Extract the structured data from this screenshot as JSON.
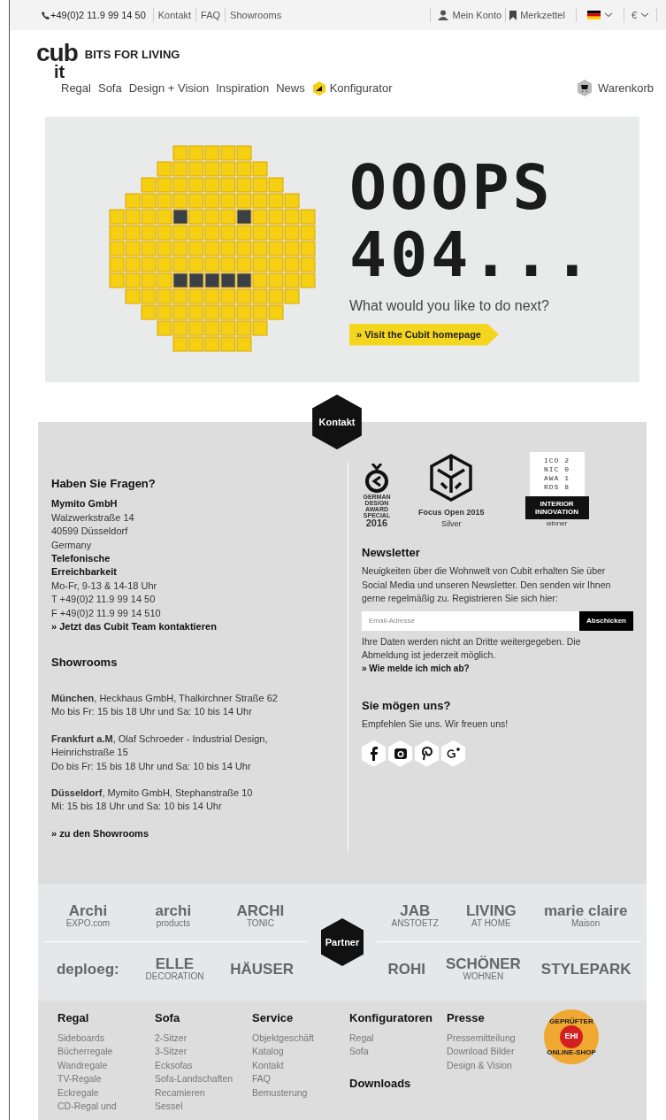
{
  "top_bar": {
    "phone": "+49(0)2 11.9 99 14 50",
    "links": [
      "Kontakt",
      "FAQ",
      "Showrooms"
    ],
    "account": "Mein Konto",
    "wishlist": "Merkzettel",
    "currency": "€"
  },
  "logo": {
    "top": "cub",
    "bottom": "it",
    "tagline": "BITS FOR LIVING"
  },
  "nav": [
    {
      "label": "Regal",
      "kind": "plain"
    },
    {
      "label": "Sofa",
      "kind": "plain"
    },
    {
      "label": "Design + Vision",
      "kind": "plain"
    },
    {
      "label": "Inspiration",
      "kind": "plain"
    },
    {
      "label": "News",
      "kind": "plain"
    },
    {
      "label": "Konfigurator",
      "kind": "configurator"
    }
  ],
  "cart": "Warenkorb",
  "hero": {
    "headline": [
      "OOOPS",
      "404..."
    ],
    "question": "What would you like to do next?",
    "button": "» Visit the Cubit homepage"
  },
  "kontakt_badge": "Kontakt",
  "contact": {
    "heading": "Haben Sie Fragen?",
    "lines": [
      {
        "text": "Mymito GmbH",
        "bold": true
      },
      {
        "text": "Walzwerkstraße 14",
        "bold": false
      },
      {
        "text": "40599 Düsseldorf",
        "bold": false
      },
      {
        "text": "Germany",
        "bold": false
      },
      {
        "text": "Telefonische",
        "bold": true
      },
      {
        "text": "Erreichbarkeit",
        "bold": true
      },
      {
        "text": "Mo-Fr, 9-13 & 14-18 Uhr",
        "bold": false
      },
      {
        "text": "T +49(0)2 11.9 99 14 50",
        "bold": false
      },
      {
        "text": "F +49(0)2 11.9 99 14 510",
        "bold": false
      }
    ],
    "link": "» Jetzt das Cubit Team kontaktieren"
  },
  "showrooms": {
    "heading": "Showrooms",
    "entries": [
      [
        "**München**, Heckhaus GmbH, Thalkirchner Straße 62",
        "Mo bis Fr: 15 bis 18 Uhr und Sa: 10 bis 14 Uhr"
      ],
      [
        "**Frankfurt a.M**, Olaf Schroeder - Industrial Design,",
        "Heinrichstraße 15",
        "Do bis Fr: 15 bis 18 Uhr und Sa: 10 bis 14 Uhr"
      ],
      [
        "**Düsseldorf**, Mymito GmbH, Stephanstraße 10",
        "Mi: 15 bis 18 Uhr und Sa: 10 bis 14 Uhr"
      ]
    ],
    "link": "» zu den Showrooms"
  },
  "awards": [
    {
      "kind": "medal",
      "lines": [
        "GERMAN",
        "DESIGN",
        "AWARD",
        "SPECIAL",
        "2016"
      ]
    },
    {
      "kind": "cube",
      "lines": [
        "Focus Open 2015",
        "Silver"
      ]
    },
    {
      "kind": "flag",
      "lines": [
        "ICO 2",
        "NIC 0",
        "AWA 1",
        "RDS 8",
        "INTERIOR",
        "INNOVATION",
        "winner"
      ]
    }
  ],
  "newsletter": {
    "heading": "Newsletter",
    "text": "Neuigkeiten über die Wohnwelt von Cubit erhalten Sie über Social Media und unseren Newsletter. Den senden wir Ihnen gerne regelmäßig zu. Registrieren Sie sich hier:",
    "placeholder": "Email-Adresse",
    "button": "Abschicken",
    "note": "Ihre Daten werden nicht an Dritte weitergegeben. Die Abmeldung ist jederzeit möglich.",
    "link": "» Wie melde ich mich ab?"
  },
  "social": {
    "heading": "Sie mögen uns?",
    "text": "Empfehlen Sie uns. Wir freuen uns!"
  },
  "partners": {
    "label": "Partner",
    "left": [
      [
        [
          "Archi",
          "EXPO.com"
        ],
        [
          "archi",
          "products"
        ],
        [
          "ARCHI",
          "TONIC"
        ]
      ],
      [
        [
          "deploeg:"
        ],
        [
          "ELLE",
          "DECORATION"
        ],
        [
          "HÄUSER"
        ]
      ]
    ],
    "right": [
      [
        [
          "JAB",
          "ANSTOETZ"
        ],
        [
          "LIVING",
          "AT HOME"
        ],
        [
          "marie claire",
          "Maison"
        ]
      ],
      [
        [
          "ROHI"
        ],
        [
          "SCHÖNER",
          "WOHNEN"
        ],
        [
          "STYLEPARK"
        ]
      ]
    ]
  },
  "footer": {
    "columns": [
      {
        "heading": "Regal",
        "items": [
          "Sideboards",
          "Bücherregale",
          "Wandregale",
          "TV-Regale",
          "Eckregale",
          "CD-Regal und"
        ]
      },
      {
        "heading": "Sofa",
        "items": [
          "2-Sitzer",
          "3-Sitzer",
          "Ecksofas",
          "Sofa-Landschaften",
          "Recamieren",
          "Sessel"
        ]
      },
      {
        "heading": "Service",
        "items": [
          "Objektgeschäft",
          "Katalog",
          "Kontakt",
          "FAQ",
          "Bemusterung"
        ]
      },
      {
        "heading": "Konfiguratoren",
        "items": [
          "Regal",
          "Sofa"
        ],
        "subheading": "Downloads"
      },
      {
        "heading": "Presse",
        "items": [
          "Pressemitteilung",
          "Download Bilder",
          "Design & Vision"
        ]
      }
    ],
    "seal": {
      "top": "GEPRÜFTER",
      "center": "EHI",
      "bottom": "ONLINE-SHOP"
    }
  }
}
